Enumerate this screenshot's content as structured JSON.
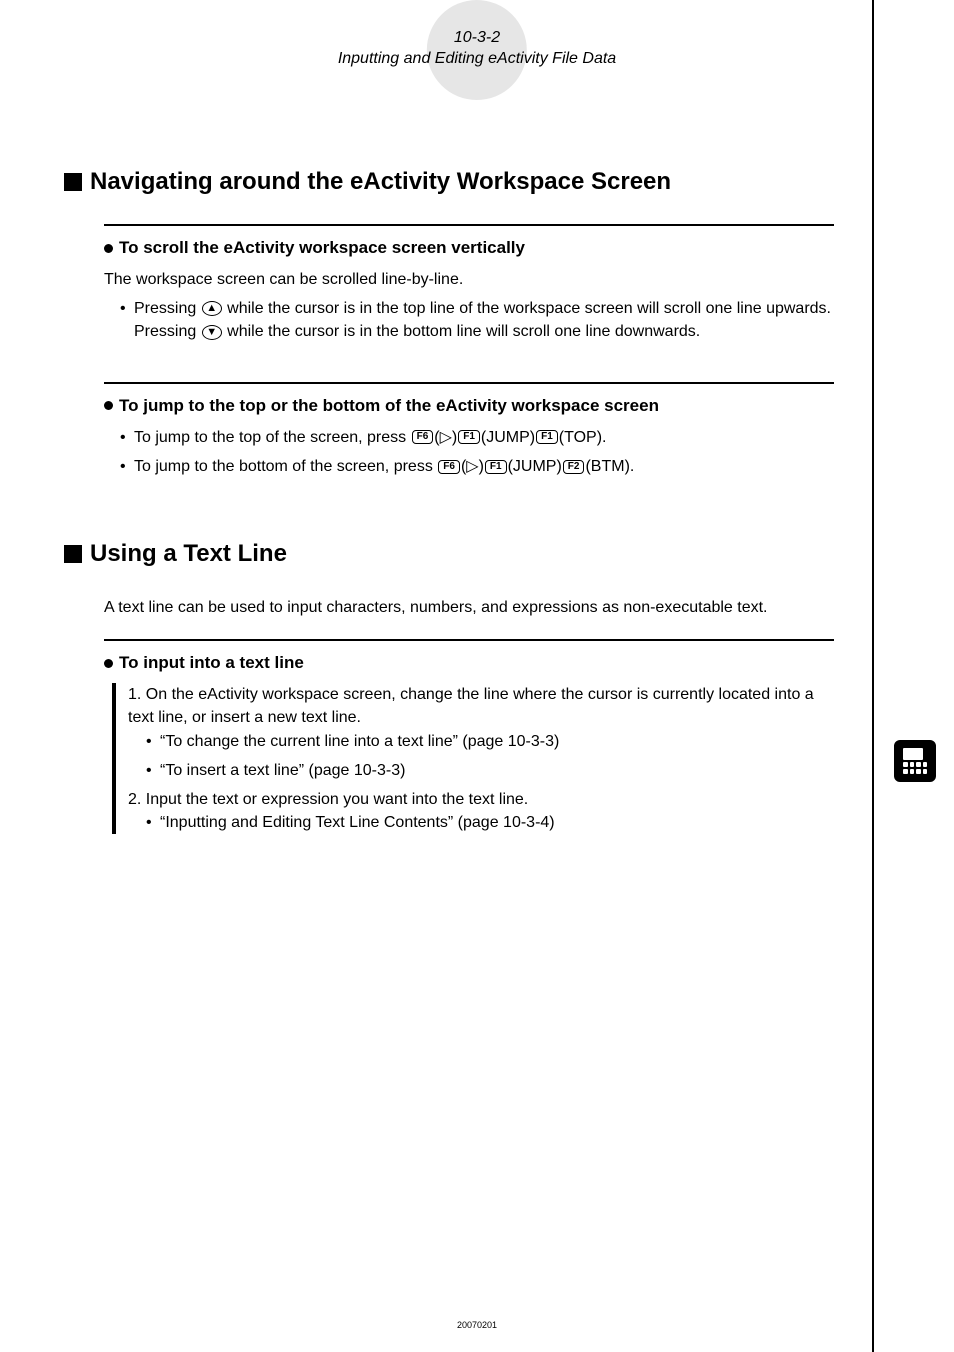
{
  "header": {
    "page_num": "10-3-2",
    "title": "Inputting and Editing eActivity File Data"
  },
  "section1": {
    "title": "Navigating around the eActivity Workspace Screen",
    "sub1": {
      "title": "To scroll the eActivity workspace screen vertically",
      "intro": "The workspace screen can be scrolled line-by-line.",
      "bullet_pre": "Pressing ",
      "bullet_mid": " while the cursor is in the top line of the workspace screen will scroll one line upwards. Pressing ",
      "bullet_post": " while the cursor is in the bottom line will scroll one line downwards."
    },
    "sub2": {
      "title": "To jump to the top or the bottom of the eActivity workspace screen",
      "li1_pre": "To jump to the top of the screen, press ",
      "li2_pre": "To jump to the bottom of the screen, press ",
      "keys": {
        "f6": "F6",
        "f1": "F1",
        "f2": "F2",
        "tri": "▷",
        "jump": "(JUMP)",
        "top": "(TOP).",
        "btm": "(BTM)."
      },
      "arrows": {
        "up": "▲",
        "down": "▼"
      },
      "paren_tri": "(▷)"
    }
  },
  "section2": {
    "title": "Using a Text Line",
    "intro": "A text line can be used to input characters, numbers, and expressions as non-executable text.",
    "sub1": {
      "title": "To input into a text line",
      "step1_num": "1. ",
      "step1": "On the eActivity workspace screen, change the line where the cursor is currently located into a text line, or insert a new text line.",
      "step1_b1": "“To change the current line into a text line” (page 10-3-3)",
      "step1_b2": "“To insert a text line” (page 10-3-3)",
      "step2_num": "2. ",
      "step2": "Input the text or expression you want into the text line.",
      "step2_b1": "“Inputting and Editing Text Line Contents” (page 10-3-4)"
    }
  },
  "footer": {
    "code": "20070201"
  }
}
